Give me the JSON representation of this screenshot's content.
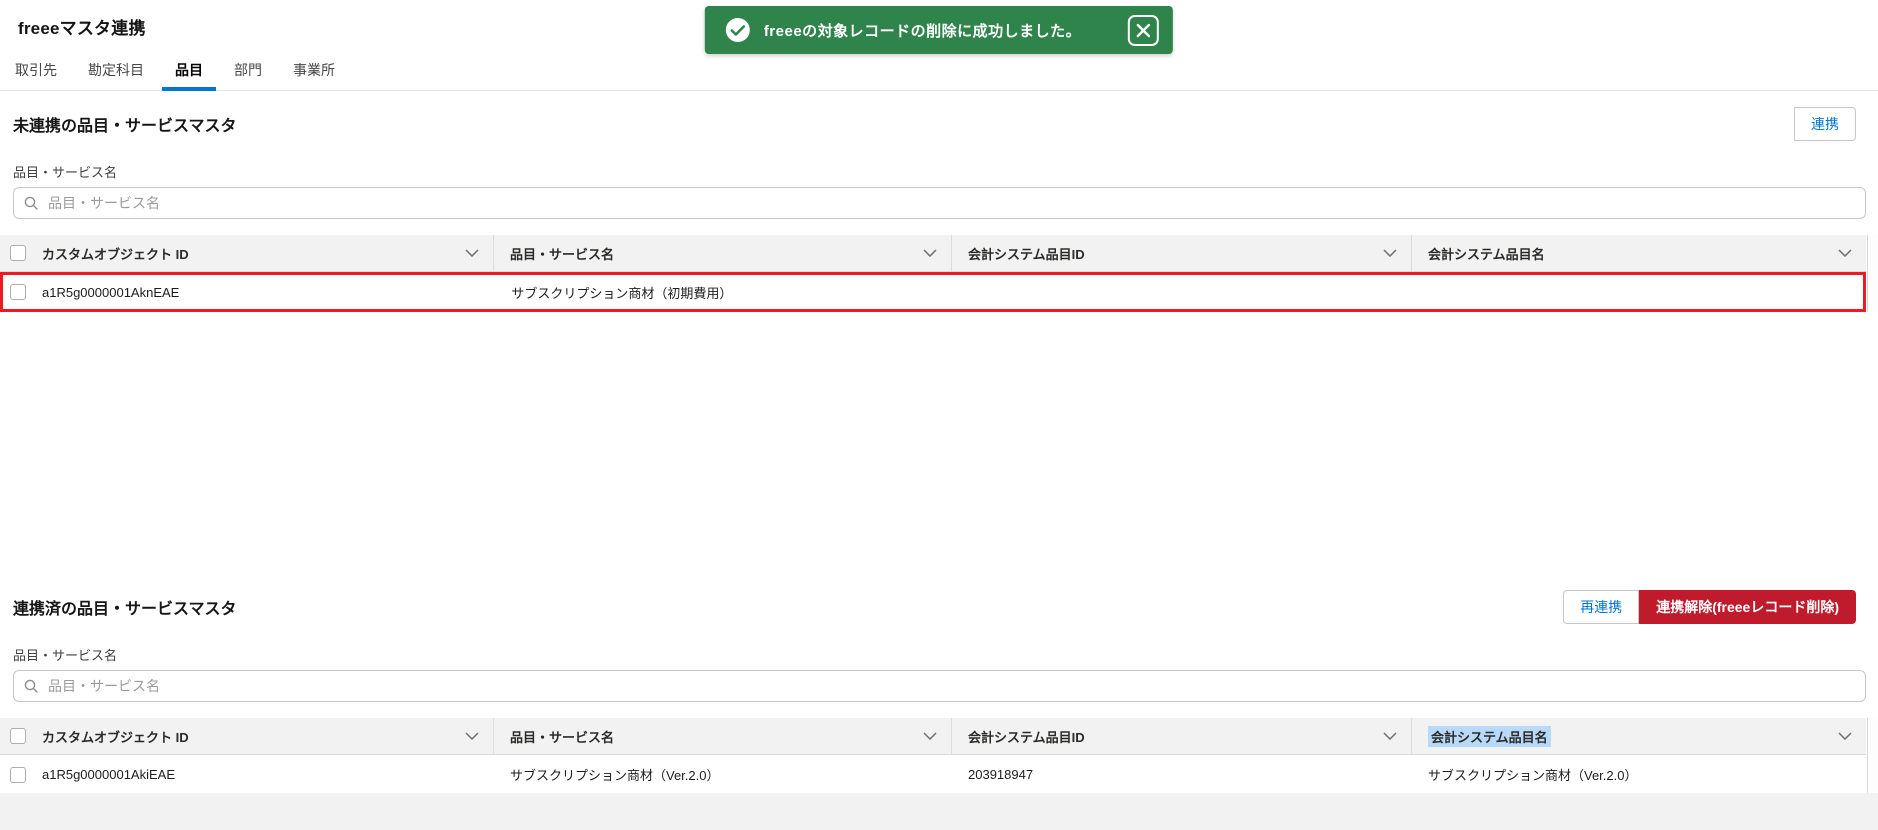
{
  "page": {
    "title": "freeeマスタ連携"
  },
  "toast": {
    "message": "freeeの対象レコードの削除に成功しました。",
    "icon": "success-check-icon",
    "close_icon": "close-icon"
  },
  "tabs": [
    {
      "label": "取引先",
      "active": false
    },
    {
      "label": "勘定科目",
      "active": false
    },
    {
      "label": "品目",
      "active": true
    },
    {
      "label": "部門",
      "active": false
    },
    {
      "label": "事業所",
      "active": false
    }
  ],
  "sections": [
    {
      "heading": "未連携の品目・サービスマスタ",
      "filter_label": "品目・サービス名",
      "search_placeholder": "品目・サービス名",
      "search_value": "",
      "actions": [
        {
          "label": "連携",
          "style": "neutral"
        }
      ],
      "table": {
        "columns": [
          "カスタムオブジェクト ID",
          "品目・サービス名",
          "会計システム品目ID",
          "会計システム品目名"
        ],
        "rows": [
          {
            "cells": [
              "a1R5g0000001AknEAE",
              "サブスクリプション商材（初期費用）",
              "",
              ""
            ],
            "highlighted": true,
            "checked": false
          }
        ]
      }
    },
    {
      "heading": "連携済の品目・サービスマスタ",
      "filter_label": "品目・サービス名",
      "search_placeholder": "品目・サービス名",
      "search_value": "",
      "actions": [
        {
          "label": "再連携",
          "style": "neutral"
        },
        {
          "label": "連携解除(freeeレコード削除)",
          "style": "destructive"
        }
      ],
      "table": {
        "columns": [
          "カスタムオブジェクト ID",
          "品目・サービス名",
          "会計システム品目ID",
          "会計システム品目名"
        ],
        "highlighted_column": "会計システム品目名",
        "rows": [
          {
            "cells": [
              "a1R5g0000001AkiEAE",
              "サブスクリプション商材（Ver.2.0）",
              "203918947",
              "サブスクリプション商材（Ver.2.0）"
            ],
            "highlighted": false,
            "checked": false
          }
        ]
      }
    }
  ],
  "icons": {
    "success_check": "✓",
    "close": "✕",
    "search": "⌕",
    "chevron_down": "∨"
  },
  "colors": {
    "accent_blue": "#0176d3",
    "toast_success_green": "#2e844a",
    "destructive_red": "#bf1b2c",
    "row_highlight_red": "#ee1b23",
    "header_selection_blue": "#b9d9f9",
    "table_header_bg": "#f2f2f2"
  }
}
